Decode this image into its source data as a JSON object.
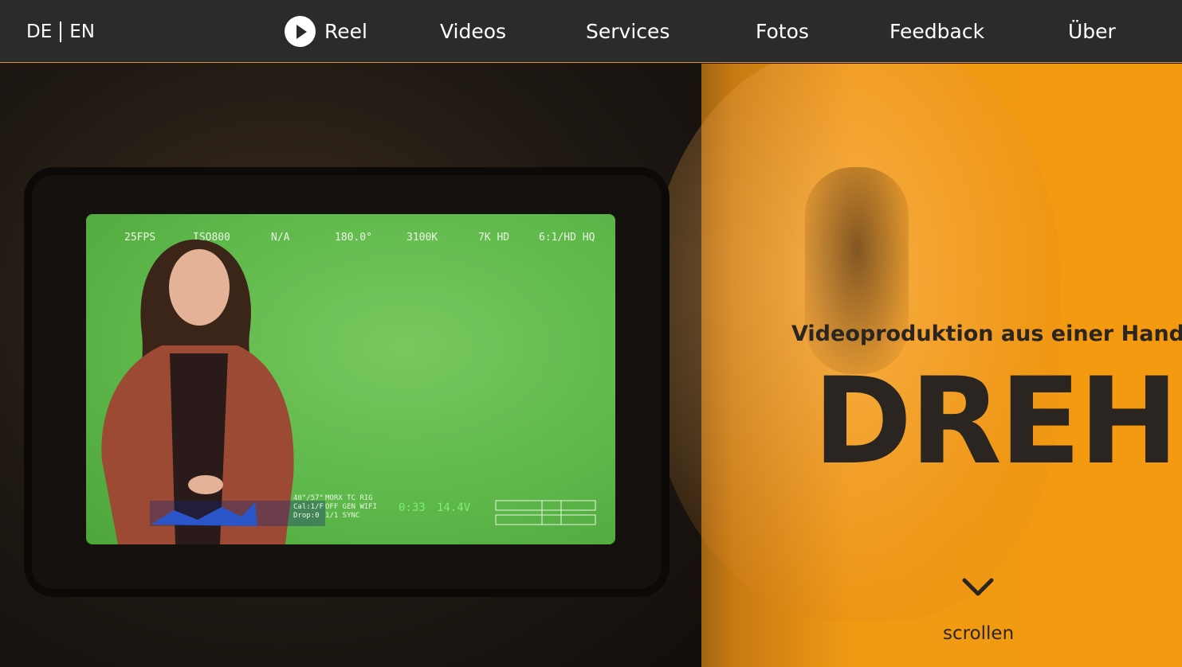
{
  "nav": {
    "lang": [
      "DE",
      "EN"
    ],
    "items": [
      {
        "label": "Reel",
        "icon": "play-icon"
      },
      {
        "label": "Videos"
      },
      {
        "label": "Services"
      },
      {
        "label": "Fotos"
      },
      {
        "label": "Feedback"
      },
      {
        "label": "Über"
      }
    ]
  },
  "hero": {
    "subtitle": "Videoproduktion aus einer Hand",
    "headline": "DREH",
    "scroll_label": "scrollen",
    "scroll_icon": "chevron-down-icon"
  },
  "monitor": {
    "hud": [
      "25FPS",
      "ISO800",
      "N/A",
      "180.0°",
      "3100K",
      "7K HD",
      "6:1/HD HQ"
    ],
    "voltage": "14.4V",
    "timecode": "0:33"
  },
  "colors": {
    "nav_bg": "#2b2b2b",
    "accent": "#f59a10",
    "text_dark": "#2a2520"
  }
}
